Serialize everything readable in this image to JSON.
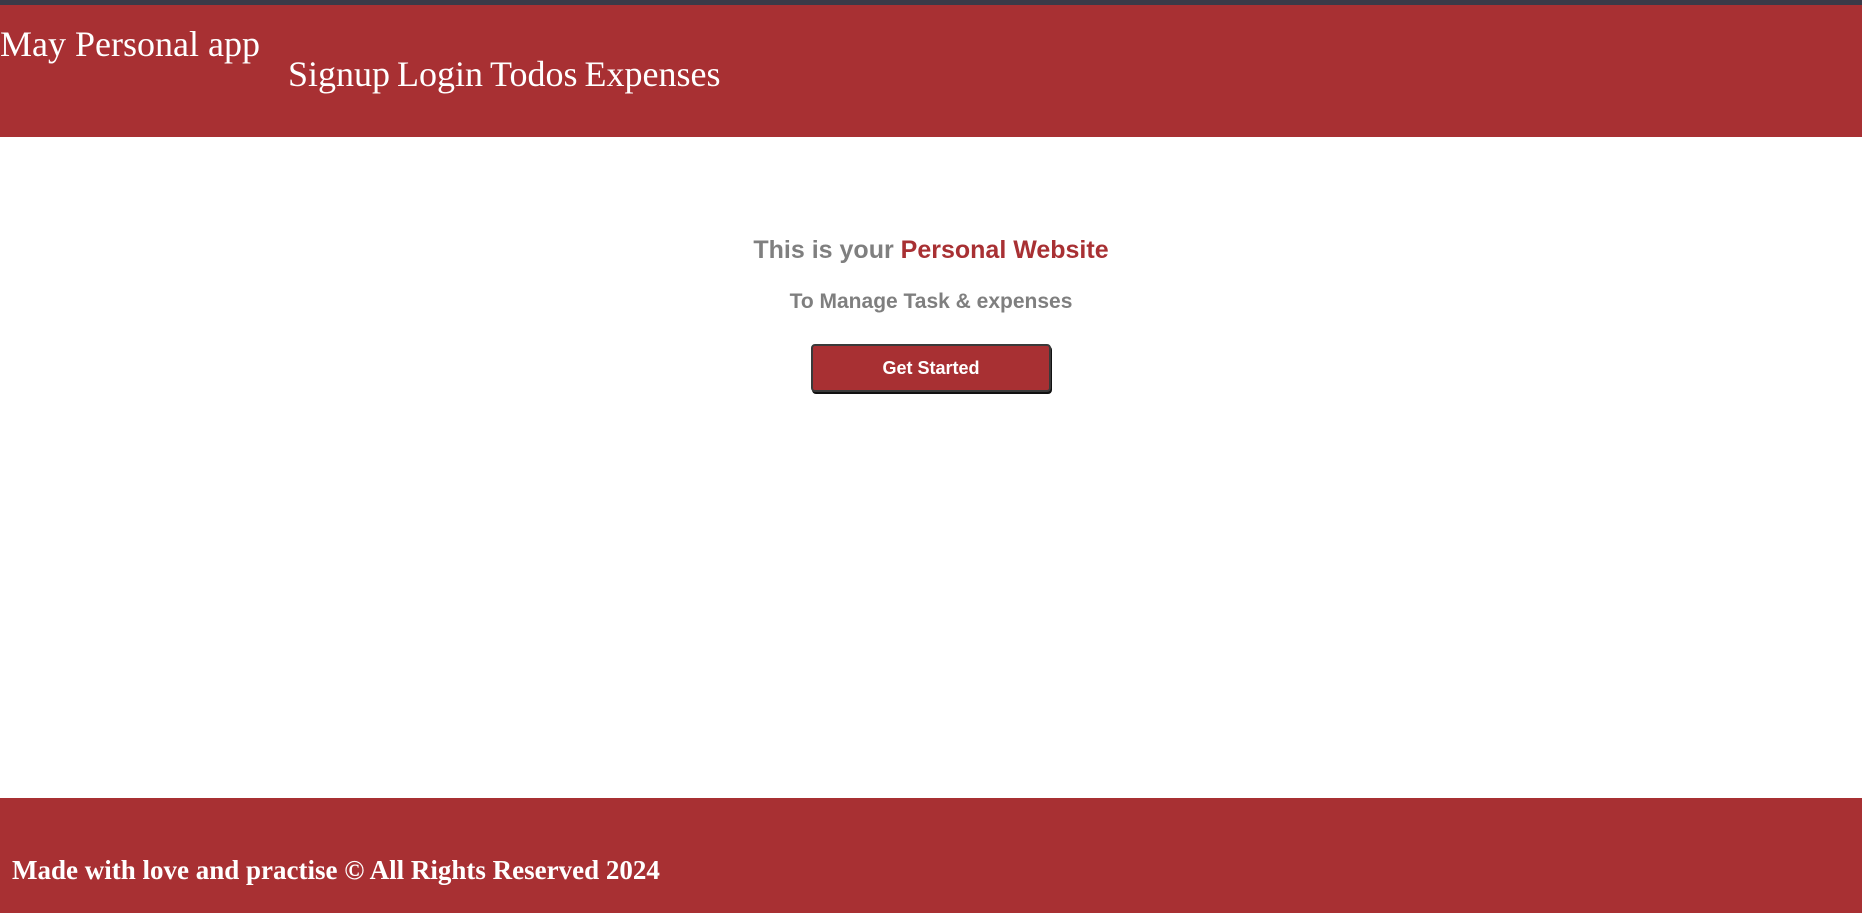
{
  "header": {
    "brand": "May Personal app",
    "nav": [
      {
        "label": "Signup"
      },
      {
        "label": "Login"
      },
      {
        "label": "Todos"
      },
      {
        "label": "Expenses"
      }
    ]
  },
  "hero": {
    "title_prefix": "This is your ",
    "title_accent": "Personal Website",
    "subtitle": "To Manage Task & expenses",
    "cta_label": "Get Started"
  },
  "footer": {
    "text": "Made with love and practise © All Rights Reserved 2024"
  },
  "colors": {
    "brand": "#a83033",
    "muted_text": "#7f7f7f",
    "top_strip": "#3a3a48"
  }
}
